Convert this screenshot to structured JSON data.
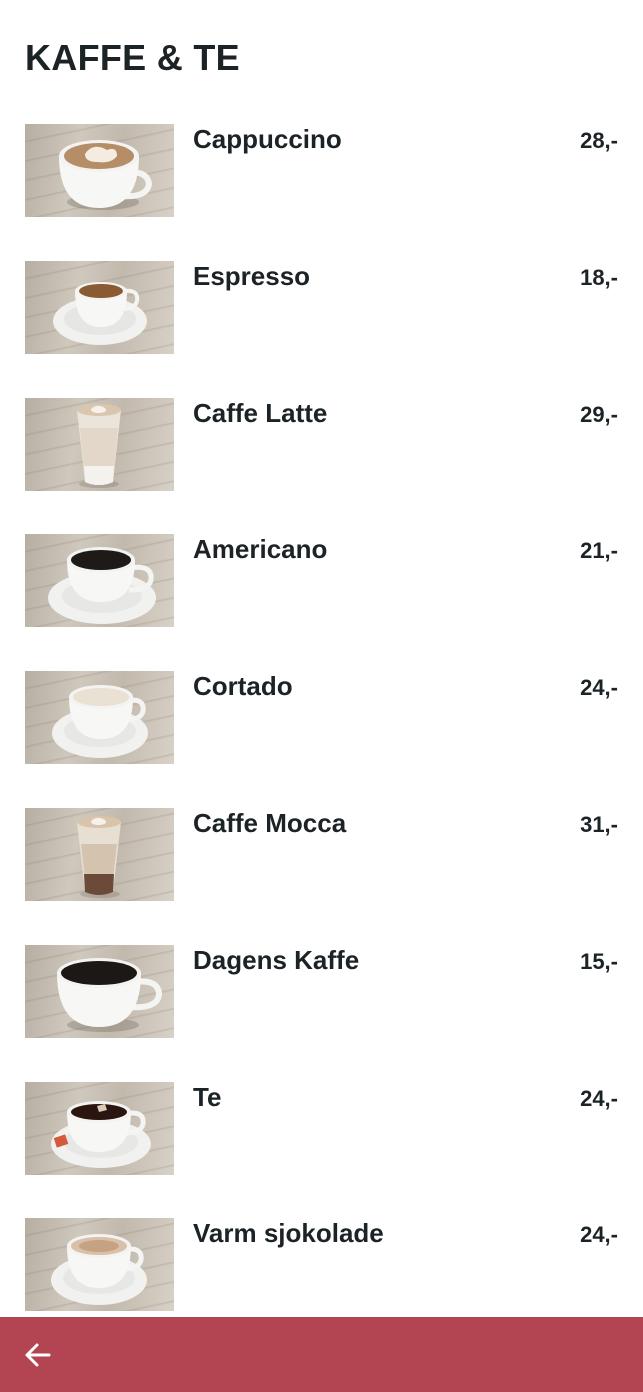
{
  "header": {
    "title": "KAFFE & TE"
  },
  "menu": {
    "items": [
      {
        "name": "Cappuccino",
        "price": "28,-",
        "image": "cappuccino-cup-image"
      },
      {
        "name": "Espresso",
        "price": "18,-",
        "image": "espresso-cup-image"
      },
      {
        "name": "Caffe Latte",
        "price": "29,-",
        "image": "latte-glass-image"
      },
      {
        "name": "Americano",
        "price": "21,-",
        "image": "americano-cup-image"
      },
      {
        "name": "Cortado",
        "price": "24,-",
        "image": "cortado-cup-image"
      },
      {
        "name": "Caffe Mocca",
        "price": "31,-",
        "image": "mocca-glass-image"
      },
      {
        "name": "Dagens Kaffe",
        "price": "15,-",
        "image": "coffee-cup-image"
      },
      {
        "name": "Te",
        "price": "24,-",
        "image": "tea-cup-image"
      },
      {
        "name": "Varm sjokolade",
        "price": "24,-",
        "image": "hot-chocolate-cup-image"
      }
    ]
  },
  "bottom_bar": {
    "back_icon": "arrow-left-icon",
    "color": "#b34552"
  }
}
